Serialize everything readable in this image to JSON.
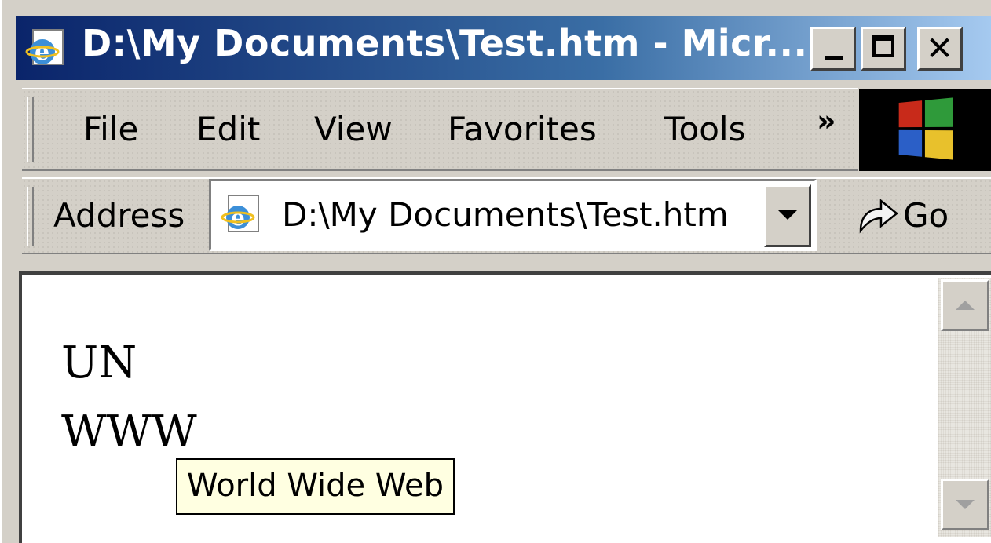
{
  "window": {
    "title": "D:\\My Documents\\Test.htm - Micr...",
    "title_gradient": [
      "#0a246a",
      "#a6caf0"
    ],
    "chrome_color": "#d4d0c8",
    "icons": [
      "ie-icon",
      "minimize-icon",
      "maximize-icon",
      "close-icon"
    ]
  },
  "menubar": {
    "items": [
      {
        "label": "File"
      },
      {
        "label": "Edit"
      },
      {
        "label": "View"
      },
      {
        "label": "Favorites"
      },
      {
        "label": "Tools"
      }
    ],
    "overflow_label": "»",
    "logo_icon": "windows-flag-logo"
  },
  "address_bar": {
    "label": "Address",
    "value": "D:\\My Documents\\Test.htm",
    "go_label": "Go",
    "icons": [
      "ie-page-icon",
      "dropdown-arrow-icon",
      "go-arrow-icon"
    ]
  },
  "content": {
    "lines": [
      "UN",
      "WWW"
    ],
    "tooltip": "World Wide Web",
    "tooltip_bg": "#ffffe1"
  },
  "scrollbar": {
    "icons": [
      "scroll-up-arrow-icon",
      "scroll-down-arrow-icon"
    ]
  }
}
